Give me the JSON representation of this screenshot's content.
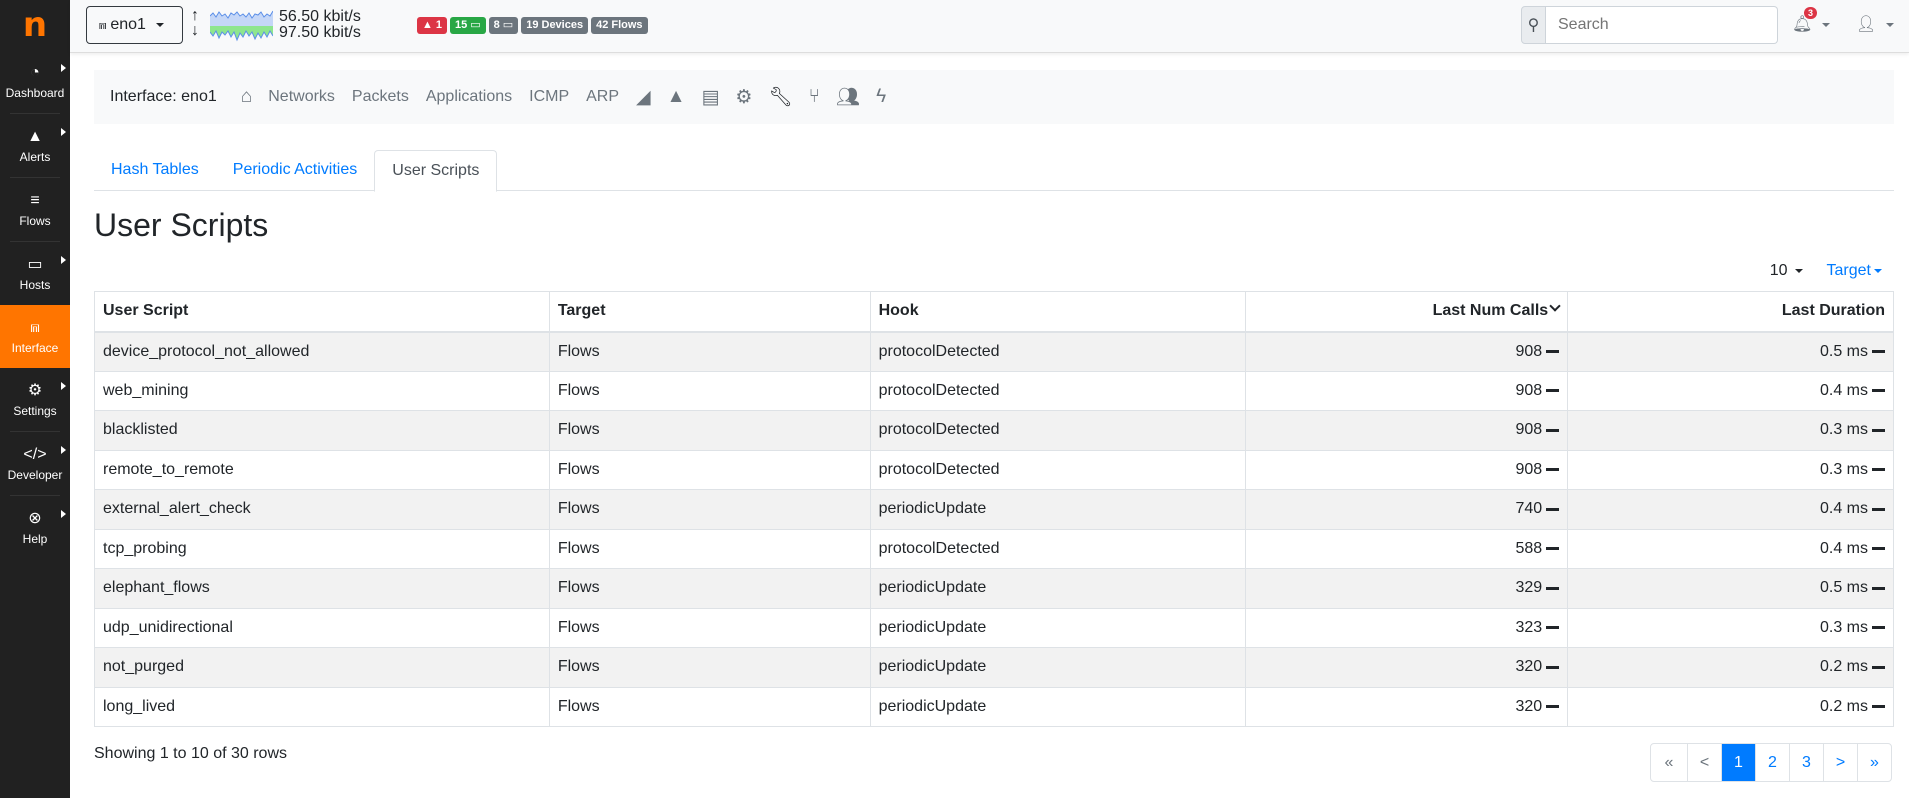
{
  "sidebar": {
    "logo": "n",
    "items": [
      {
        "label": "Dashboard",
        "icon": "dashboard-icon",
        "glyph": "◔",
        "has_submenu": true
      },
      {
        "label": "Alerts",
        "icon": "warning-icon",
        "glyph": "▲",
        "has_submenu": true
      },
      {
        "label": "Flows",
        "icon": "stream-icon",
        "glyph": "≡",
        "has_submenu": false
      },
      {
        "label": "Hosts",
        "icon": "laptop-icon",
        "glyph": "▭",
        "has_submenu": true
      },
      {
        "label": "Interface",
        "icon": "ethernet-icon",
        "glyph": "⩎",
        "has_submenu": false,
        "active": true
      },
      {
        "label": "Settings",
        "icon": "gear-icon",
        "glyph": "⚙",
        "has_submenu": true
      },
      {
        "label": "Developer",
        "icon": "code-icon",
        "glyph": "</>",
        "has_submenu": true
      },
      {
        "label": "Help",
        "icon": "lifering-icon",
        "glyph": "⊗",
        "has_submenu": true
      }
    ]
  },
  "topbar": {
    "interface_name": "eno1",
    "upload_rate": "56.50 kbit/s",
    "download_rate": "97.50 kbit/s",
    "badges": {
      "alerts": "1",
      "local_hosts": "15",
      "remote_hosts": "8",
      "devices": "19 Devices",
      "flows": "42 Flows"
    },
    "search_placeholder": "Search",
    "notifications_count": "3",
    "colors": {
      "accent": "#ff7500",
      "link": "#007bff",
      "danger": "#dc3545",
      "success": "#28a745",
      "secondary": "#6c757d"
    }
  },
  "subnav": {
    "title": "Interface: eno1",
    "links": [
      "Networks",
      "Packets",
      "Applications",
      "ICMP",
      "ARP"
    ]
  },
  "tabs": [
    {
      "label": "Hash Tables",
      "active": false
    },
    {
      "label": "Periodic Activities",
      "active": false
    },
    {
      "label": "User Scripts",
      "active": true
    }
  ],
  "page_title": "User Scripts",
  "toolbar": {
    "page_size": "10",
    "filter_label": "Target"
  },
  "table": {
    "columns": [
      "User Script",
      "Target",
      "Hook",
      "Last Num Calls",
      "Last Duration"
    ],
    "sorted_by": "Last Num Calls",
    "rows": [
      {
        "script": "device_protocol_not_allowed",
        "target": "Flows",
        "hook": "protocolDetected",
        "calls": "908",
        "duration": "0.5 ms"
      },
      {
        "script": "web_mining",
        "target": "Flows",
        "hook": "protocolDetected",
        "calls": "908",
        "duration": "0.4 ms"
      },
      {
        "script": "blacklisted",
        "target": "Flows",
        "hook": "protocolDetected",
        "calls": "908",
        "duration": "0.3 ms"
      },
      {
        "script": "remote_to_remote",
        "target": "Flows",
        "hook": "protocolDetected",
        "calls": "908",
        "duration": "0.3 ms"
      },
      {
        "script": "external_alert_check",
        "target": "Flows",
        "hook": "periodicUpdate",
        "calls": "740",
        "duration": "0.4 ms"
      },
      {
        "script": "tcp_probing",
        "target": "Flows",
        "hook": "protocolDetected",
        "calls": "588",
        "duration": "0.4 ms"
      },
      {
        "script": "elephant_flows",
        "target": "Flows",
        "hook": "periodicUpdate",
        "calls": "329",
        "duration": "0.5 ms"
      },
      {
        "script": "udp_unidirectional",
        "target": "Flows",
        "hook": "periodicUpdate",
        "calls": "323",
        "duration": "0.3 ms"
      },
      {
        "script": "not_purged",
        "target": "Flows",
        "hook": "periodicUpdate",
        "calls": "320",
        "duration": "0.2 ms"
      },
      {
        "script": "long_lived",
        "target": "Flows",
        "hook": "periodicUpdate",
        "calls": "320",
        "duration": "0.2 ms"
      }
    ]
  },
  "footer": {
    "showing": "Showing 1 to 10 of 30 rows",
    "pagination": {
      "first": "«",
      "prev": "<",
      "pages": [
        "1",
        "2",
        "3"
      ],
      "current": "1",
      "next": ">",
      "last": "»"
    }
  }
}
